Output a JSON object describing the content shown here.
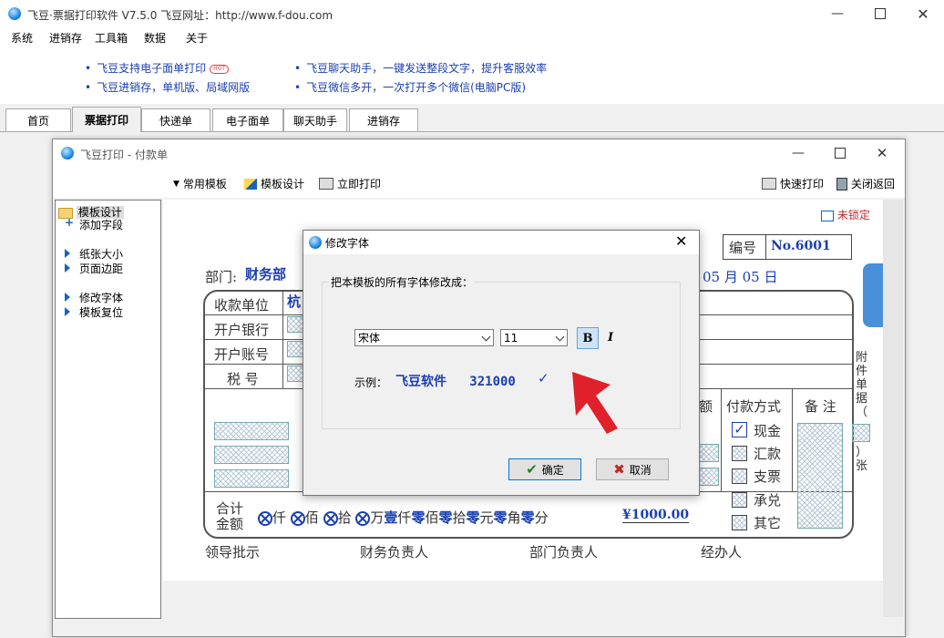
{
  "app": {
    "title": "飞豆·票据打印软件 V7.5.0   飞豆网址：http://www.f-dou.com"
  },
  "menu": [
    "系统",
    "进销存",
    "工具箱",
    "数据",
    "关于"
  ],
  "info": {
    "left1": "飞豆支持电子面单打印",
    "hot": "HOT",
    "left2": "飞豆进销存，单机版、局域网版",
    "right1": "飞豆聊天助手，一键发送整段文字，提升客服效率",
    "right2": "飞豆微信多开，一次打开多个微信(电脑PC版)"
  },
  "tabs": [
    "首页",
    "票据打印",
    "快递单",
    "电子面单",
    "聊天助手",
    "进销存"
  ],
  "child": {
    "title": "飞豆打印 - 付款单",
    "toolbar": {
      "templates": "常用模板",
      "design": "模板设计",
      "print_now": "立即打印",
      "quick_print": "快速打印",
      "close_return": "关闭返回"
    },
    "tree": {
      "root": "模板设计",
      "add_field": "添加字段",
      "paper_size": "纸张大小",
      "margins": "页面边距",
      "change_font": "修改字体",
      "reset_template": "模板复位"
    }
  },
  "form": {
    "unlocked": "未锁定",
    "number_label": "编号",
    "number_value": "No.6001",
    "dept_label": "部门:",
    "dept_value": "财务部",
    "date_text": "05 月  05 日",
    "payee_label": "收款单位",
    "payee_value": "杭",
    "bank_label": "开户银行",
    "account_label": "开户账号",
    "tax_label": "税  号",
    "amount_col": "额",
    "method_col": "付款方式",
    "note_col": "备 注",
    "methods": [
      "现金",
      "汇款",
      "支票",
      "承兑",
      "其它"
    ],
    "attach": "附件单据（",
    "attach_tail": "）张",
    "total_label1": "合计",
    "total_label2": "金额",
    "units": [
      "仟",
      "佰",
      "拾",
      "万",
      "仟",
      "佰",
      "拾",
      "元",
      "角",
      "分"
    ],
    "digits": [
      "壹",
      "零",
      "零",
      "零",
      "零",
      "零"
    ],
    "total_value": "¥1000.00",
    "sign_leader": "领导批示",
    "sign_finance": "财务负责人",
    "sign_dept": "部门负责人",
    "sign_handler": "经办人"
  },
  "dialog": {
    "title": "修改字体",
    "prompt": "把本模板的所有字体修改成：",
    "font": "宋体",
    "size": "11",
    "bold": "B",
    "italic": "I",
    "sample_label": "示例：",
    "sample_text": "飞豆软件   321000",
    "ok": "确定",
    "cancel": "取消"
  }
}
